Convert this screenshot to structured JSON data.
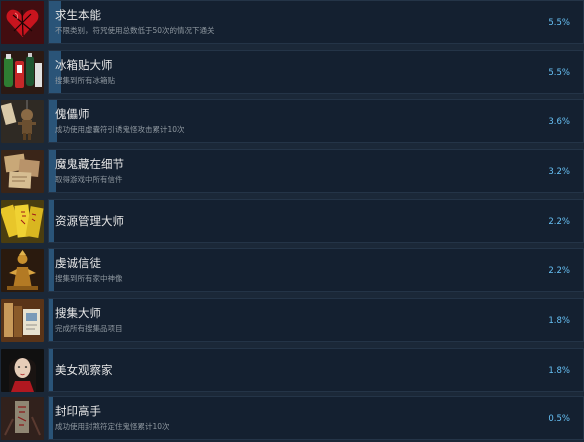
{
  "achievements": [
    {
      "title": "求生本能",
      "description": "不限类别，符咒使用总数低于50次的情况下通关",
      "percent": "5.5%",
      "progress": 5.5,
      "icon": "heart-thorns-icon"
    },
    {
      "title": "冰箱贴大师",
      "description": "搜集到所有冰箱贴",
      "percent": "5.5%",
      "progress": 5.5,
      "icon": "fridge-magnets-icon"
    },
    {
      "title": "傀儡师",
      "description": "成功使用虚囊符引诱鬼怪攻击累计10次",
      "percent": "3.6%",
      "progress": 3.6,
      "icon": "puppet-doll-icon"
    },
    {
      "title": "魔鬼藏在细节",
      "description": "取得游戏中所有信件",
      "percent": "3.2%",
      "progress": 3.2,
      "icon": "letters-icon"
    },
    {
      "title": "资源管理大师",
      "description": "",
      "percent": "2.2%",
      "progress": 2.2,
      "icon": "yellow-talismans-icon"
    },
    {
      "title": "虔诚信徒",
      "description": "搜集到所有家中神像",
      "percent": "2.2%",
      "progress": 2.2,
      "icon": "golden-idol-icon"
    },
    {
      "title": "搜集大师",
      "description": "完成所有搜集品项目",
      "percent": "1.8%",
      "progress": 1.8,
      "icon": "collectibles-icon"
    },
    {
      "title": "美女观察家",
      "description": "",
      "percent": "1.8%",
      "progress": 1.8,
      "icon": "woman-portrait-icon"
    },
    {
      "title": "封印高手",
      "description": "成功使用封煞符定住鬼怪累计10次",
      "percent": "0.5%",
      "progress": 0.5,
      "icon": "sealing-talisman-icon"
    }
  ]
}
